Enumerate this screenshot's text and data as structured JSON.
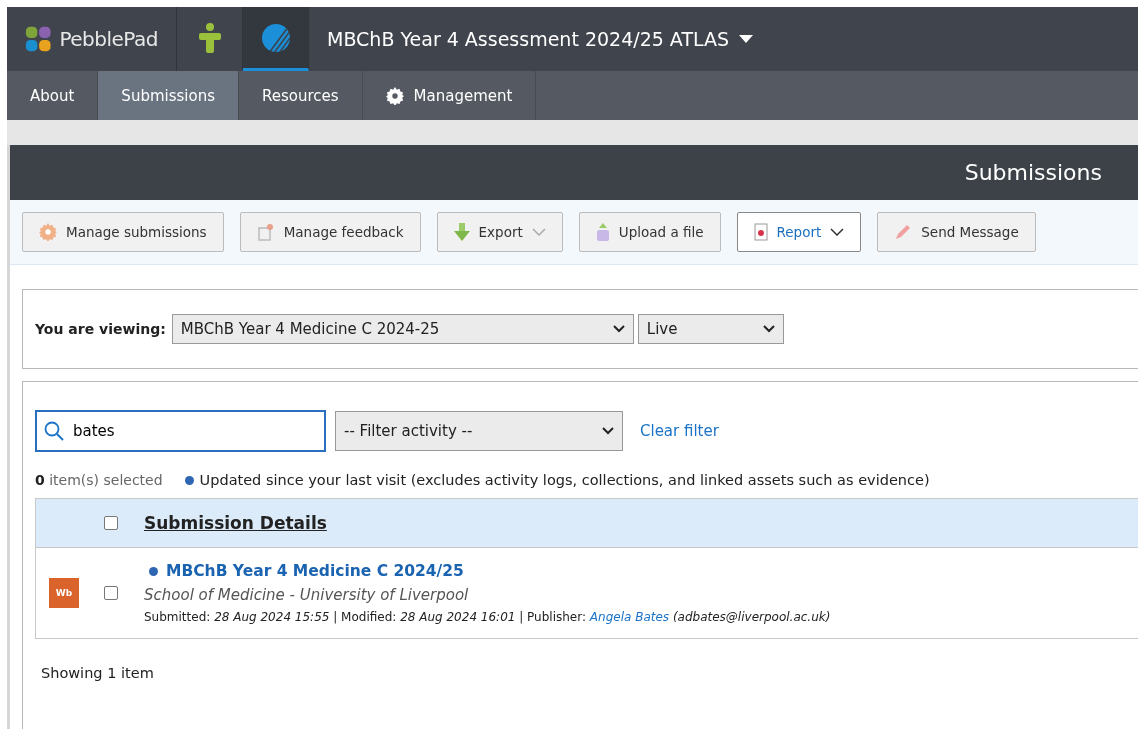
{
  "header": {
    "logo": "PebblePad",
    "apps": [
      {
        "kind": "person",
        "selected": false
      },
      {
        "kind": "atlas",
        "selected": true
      }
    ],
    "title": "MBChB Year 4 Assessment 2024/25 ATLAS"
  },
  "nav": [
    {
      "label": "About",
      "selected": false
    },
    {
      "label": "Submissions",
      "selected": true
    },
    {
      "label": "Resources",
      "selected": false
    },
    {
      "label": "Management",
      "selected": false,
      "kind": "gear"
    }
  ],
  "panel_title": "Submissions",
  "toolbar": [
    {
      "label": "Manage submissions",
      "kind": "gear",
      "caret": false,
      "selected": false
    },
    {
      "label": "Manage feedback",
      "kind": "feedback",
      "caret": false,
      "selected": false
    },
    {
      "label": "Export",
      "kind": "download",
      "caret": true,
      "selected": false
    },
    {
      "label": "Upload a file",
      "kind": "upload",
      "caret": false,
      "selected": false
    },
    {
      "label": "Report",
      "kind": "report",
      "caret": true,
      "selected": true
    },
    {
      "label": "Send Message",
      "kind": "pencil",
      "caret": false,
      "selected": false
    }
  ],
  "viewing": {
    "label": "You are viewing:",
    "workspace": "MBChB Year 4 Medicine C 2024-25",
    "status": "Live"
  },
  "search": {
    "value": "bates"
  },
  "filter": {
    "value": "-- Filter activity --"
  },
  "clear_filter": "Clear filter",
  "selected_count": "**0** item(s) selected",
  "legend": "Updated since your last visit (excludes activity logs, collections, and linked assets such as evidence)",
  "table": {
    "header_checked": false,
    "column": "Submission Details",
    "rows": [
      {
        "badge": "Wb",
        "checked": false,
        "updated": true,
        "title": "MBChB Year 4 Medicine C 2024/25",
        "subtitle": "School of Medicine - University of Liverpool",
        "submitted_label": "Submitted:",
        "submitted": "28 Aug 2024 15:55",
        "modified_label": "| Modified:",
        "modified": "28 Aug 2024 16:01",
        "publisher_label": "| Publisher:",
        "publisher": "Angela Bates",
        "email": "(adbates@liverpool.ac.uk)"
      }
    ]
  },
  "footer": "Showing 1 item"
}
